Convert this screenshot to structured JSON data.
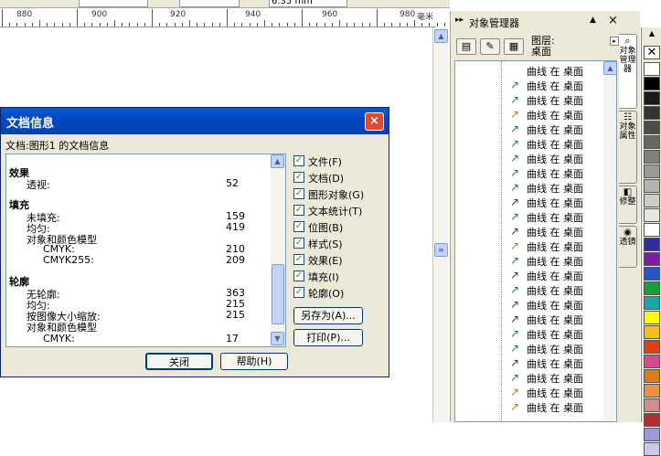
{
  "toolbar": {
    "unit_value": "6.35 mm"
  },
  "ruler": {
    "labels": [
      "880",
      "900",
      "920",
      "940",
      "960",
      "980"
    ],
    "unit": "毫米"
  },
  "docker": {
    "title": "对象管理器",
    "layer": {
      "name": "图层:",
      "page": "桌面"
    },
    "item_label": "曲线 在 桌面",
    "rows": [
      "曲线 在 桌面",
      "曲线 在 桌面",
      "曲线 在 桌面",
      "曲线 在 桌面",
      "曲线 在 桌面",
      "曲线 在 桌面",
      "曲线 在 桌面",
      "曲线 在 桌面",
      "曲线 在 桌面",
      "曲线 在 桌面",
      "曲线 在 桌面",
      "曲线 在 桌面",
      "曲线 在 桌面",
      "曲线 在 桌面",
      "曲线 在 桌面",
      "曲线 在 桌面",
      "曲线 在 桌面",
      "曲线 在 桌面",
      "曲线 在 桌面",
      "曲线 在 桌面",
      "曲线 在 桌面",
      "曲线 在 桌面",
      "曲线 在 桌面",
      "曲线 在 桌面"
    ]
  },
  "sidetabs": [
    "对象管理器",
    "对象属性",
    "修整",
    "透镜"
  ],
  "palette": [
    "#ffffff",
    "#000000",
    "#1a1a1a",
    "#333333",
    "#4d4d4d",
    "#666666",
    "#808080",
    "#999999",
    "#b3b3b3",
    "#cccccc",
    "#e6e6e6",
    "#ffffff",
    "#2e2e9e",
    "#7a1fa2",
    "#2456c9",
    "#1a9e3a",
    "#19a8a8",
    "#ffff00",
    "#f2c01e",
    "#e04010",
    "#d44a8a",
    "#e07a1e",
    "#f09040",
    "#d88a8a",
    "#b03030",
    "#9a9ad8",
    "#c8c8f0"
  ],
  "dialog": {
    "title": "文档信息",
    "close_icon": "×",
    "subtitle": "文档:图形1 的文档信息",
    "sections": {
      "effects": {
        "heading": "效果",
        "perspective_label": "透视:",
        "perspective_value": "52"
      },
      "fill": {
        "heading": "填充",
        "no_fill_label": "未填充:",
        "no_fill_value": "159",
        "uniform_label": "均匀:",
        "uniform_value": "419",
        "model_label": "对象和颜色模型",
        "cmyk_label": "CMYK:",
        "cmyk_value": "210",
        "cmyk255_label": "CMYK255:",
        "cmyk255_value": "209"
      },
      "outline": {
        "heading": "轮廓",
        "no_outline_label": "无轮廓:",
        "no_outline_value": "363",
        "uniform_label": "均匀:",
        "uniform_value": "215",
        "scale_label": "按图像大小缩放:",
        "scale_value": "215",
        "model_label": "对象和颜色模型",
        "cmyk_label": "CMYK:",
        "cmyk_value": "17"
      }
    },
    "checkboxes": [
      "文件(F)",
      "文档(D)",
      "图形对象(G)",
      "文本统计(T)",
      "位图(B)",
      "样式(S)",
      "效果(E)",
      "填充(I)",
      "轮廓(O)"
    ],
    "save_as_button": "另存为(A)...",
    "print_button": "打印(P)...",
    "close_button": "关闭",
    "help_button": "帮助(H)"
  }
}
